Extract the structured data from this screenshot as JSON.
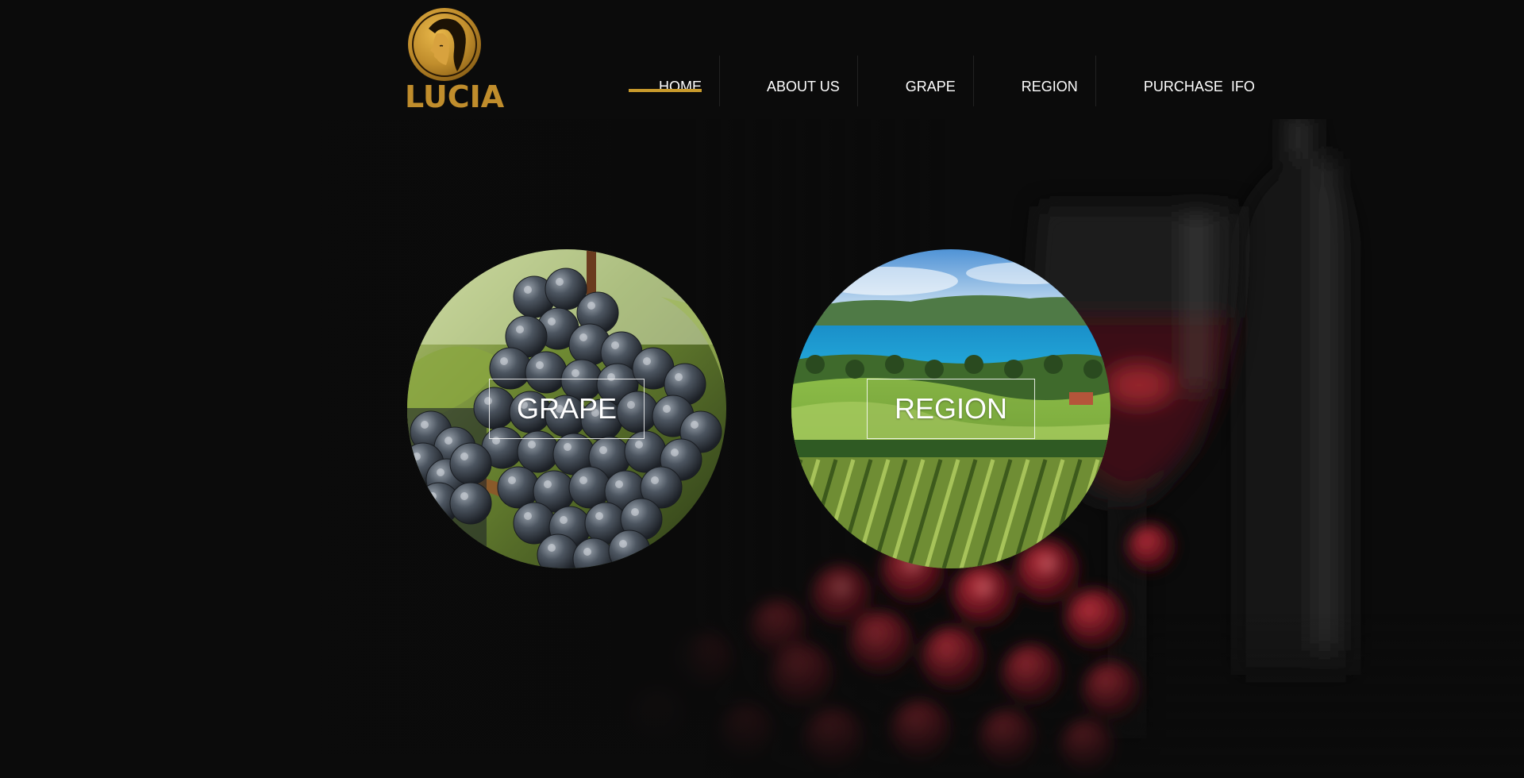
{
  "brand": {
    "name": "LUCIA",
    "logo_icon": "woman-profile-logo-icon",
    "color": "#c08d2c"
  },
  "nav": {
    "items": [
      {
        "label": "HOME",
        "active": true
      },
      {
        "label": "ABOUT US",
        "active": false
      },
      {
        "label": "GRAPE",
        "active": false
      },
      {
        "label": "REGION",
        "active": false
      },
      {
        "label": "PURCHASE  IFO",
        "active": false
      }
    ],
    "active_color": "#c89a2c"
  },
  "cards": {
    "grape": {
      "label": "GRAPE",
      "image": "dark-grape-cluster"
    },
    "region": {
      "label": "REGION",
      "image": "vineyard-by-the-sea"
    }
  },
  "background": {
    "image": "blurred-wine-bottle-glass-red-grapes",
    "base_color": "#0b0b0b"
  }
}
